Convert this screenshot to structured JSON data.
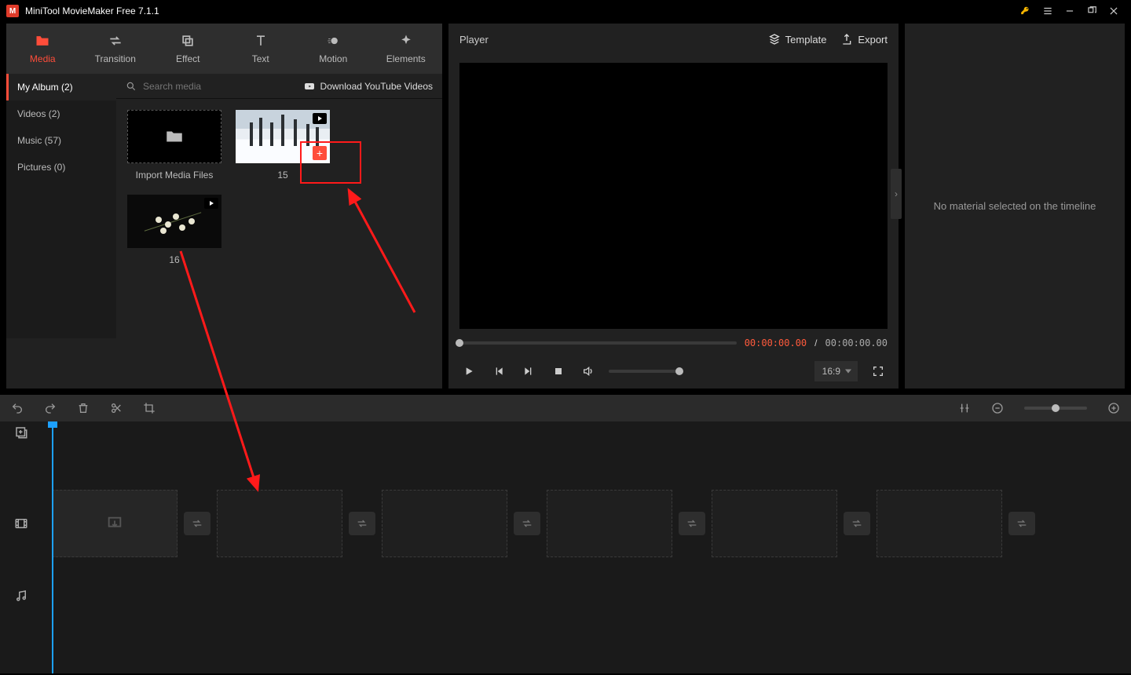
{
  "app": {
    "title": "MiniTool MovieMaker Free 7.1.1"
  },
  "media_tabs": {
    "media": "Media",
    "transition": "Transition",
    "effect": "Effect",
    "text": "Text",
    "motion": "Motion",
    "elements": "Elements"
  },
  "media_sidebar": {
    "my_album": "My Album (2)",
    "videos": "Videos (2)",
    "music": "Music (57)",
    "pictures": "Pictures (0)"
  },
  "media_toolbar": {
    "search_placeholder": "Search media",
    "youtube_link": "Download YouTube Videos"
  },
  "media_items": {
    "import_label": "Import Media Files",
    "clip1_label": "15",
    "clip2_label": "16"
  },
  "player": {
    "title": "Player",
    "template_btn": "Template",
    "export_btn": "Export",
    "time_current": "00:00:00.00",
    "time_sep": " / ",
    "time_total": "00:00:00.00",
    "aspect": "16:9"
  },
  "side_panel": {
    "empty_msg": "No material selected on the timeline"
  }
}
